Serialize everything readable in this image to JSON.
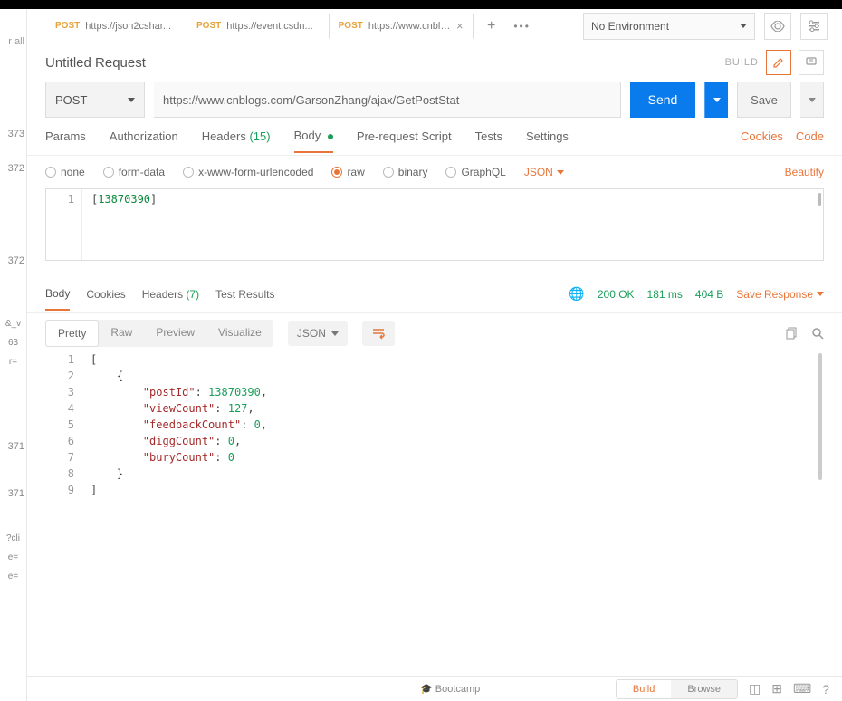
{
  "tabs": [
    {
      "method": "POST",
      "title": "https://json2cshar..."
    },
    {
      "method": "POST",
      "title": "https://event.csdn..."
    },
    {
      "method": "POST",
      "title": "https://www.cnblo..."
    }
  ],
  "environment": {
    "label": "No Environment"
  },
  "request": {
    "title": "Untitled Request",
    "build_label": "BUILD",
    "method": "POST",
    "url": "https://www.cnblogs.com/GarsonZhang/ajax/GetPostStat",
    "send_label": "Send",
    "save_label": "Save"
  },
  "req_nav": {
    "params": "Params",
    "authorization": "Authorization",
    "headers": "Headers",
    "headers_count": "(15)",
    "body": "Body",
    "prerequest": "Pre-request Script",
    "tests": "Tests",
    "settings": "Settings",
    "cookies": "Cookies",
    "code": "Code"
  },
  "body_types": {
    "none": "none",
    "formdata": "form-data",
    "xwww": "x-www-form-urlencoded",
    "raw": "raw",
    "binary": "binary",
    "graphql": "GraphQL",
    "content": "JSON",
    "beautify": "Beautify"
  },
  "request_body": {
    "line_num": "1",
    "open": "[",
    "val": "13870390",
    "close": "]"
  },
  "resp_nav": {
    "body": "Body",
    "cookies": "Cookies",
    "headers": "Headers",
    "headers_count": "(7)",
    "tests": "Test Results",
    "status": "200 OK",
    "time": "181 ms",
    "size": "404 B",
    "save": "Save Response"
  },
  "view": {
    "pretty": "Pretty",
    "raw": "Raw",
    "preview": "Preview",
    "visualize": "Visualize",
    "format": "JSON"
  },
  "response_body": {
    "lines": [
      "1",
      "2",
      "3",
      "4",
      "5",
      "6",
      "7",
      "8",
      "9"
    ],
    "data": [
      {
        "key": "postId",
        "val": "13870390",
        "comma": true
      },
      {
        "key": "viewCount",
        "val": "127",
        "comma": true
      },
      {
        "key": "feedbackCount",
        "val": "0",
        "comma": true
      },
      {
        "key": "diggCount",
        "val": "0",
        "comma": true
      },
      {
        "key": "buryCount",
        "val": "0",
        "comma": false
      }
    ]
  },
  "footer": {
    "bootcamp": "Bootcamp",
    "build": "Build",
    "browse": "Browse"
  },
  "left_gutter": {
    "all": "r all",
    "n1": "373",
    "n2": "372",
    "n3": "372",
    "frag1": "&_v",
    "frag2": "63",
    "frag3": "r=",
    "n4": "371",
    "n5": "371",
    "cli1": "?cli",
    "cli2": "e=",
    "cli3": "e="
  }
}
